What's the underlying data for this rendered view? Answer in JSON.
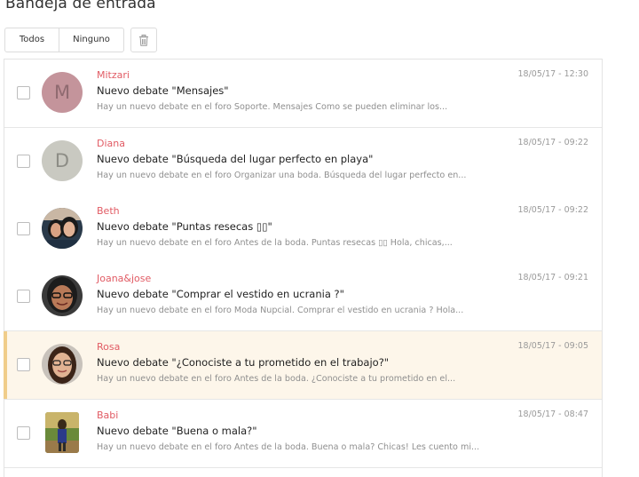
{
  "page_title": "Bandeja de entrada",
  "toolbar": {
    "select_all": "Todos",
    "select_none": "Ninguno",
    "delete_icon": "trash-icon"
  },
  "colors": {
    "sender": "#e15b64",
    "highlight_bg": "#fdf6ea",
    "highlight_bar": "#f0cd8a"
  },
  "messages": [
    {
      "sender": "Mitzari",
      "initial": "M",
      "avatar_color": "#c4949b",
      "subject": "Nuevo debate \"Mensajes\"",
      "preview": "Hay un nuevo debate en el foro Soporte. Mensajes Como se pueden eliminar los...",
      "date": "18/05/17 - 12:30"
    },
    {
      "sender": "Diana",
      "initial": "D",
      "avatar_color": "#c9c9c1",
      "subject": "Nuevo debate \"Búsqueda del lugar perfecto en playa\"",
      "preview": "Hay un nuevo debate en el foro Organizar una boda. Búsqueda del lugar perfecto en...",
      "date": "18/05/17 - 09:22"
    },
    {
      "sender": "Beth",
      "subject": "Nuevo debate \"Puntas resecas ▯▯\"",
      "preview": "Hay un nuevo debate en el foro Antes de la boda. Puntas resecas ▯▯ Hola, chicas,...",
      "date": "18/05/17 - 09:22"
    },
    {
      "sender": "Joana&jose",
      "subject": "Nuevo debate \"Comprar el vestido en ucrania ?\"",
      "preview": "Hay un nuevo debate en el foro Moda Nupcial. Comprar el vestido en ucrania ? Hola...",
      "date": "18/05/17 - 09:21"
    },
    {
      "sender": "Rosa",
      "subject": "Nuevo debate \"¿Conociste a tu prometido en el trabajo?\"",
      "preview": "Hay un nuevo debate en el foro Antes de la boda. ¿Conociste a tu prometido en el...",
      "date": "18/05/17 - 09:05"
    },
    {
      "sender": "Babi",
      "subject": "Nuevo debate \"Buena o mala?\"",
      "preview": "Hay un nuevo debate en el foro Antes de la boda. Buena o mala? Chicas! Les cuento mi...",
      "date": "18/05/17 - 08:47"
    }
  ]
}
